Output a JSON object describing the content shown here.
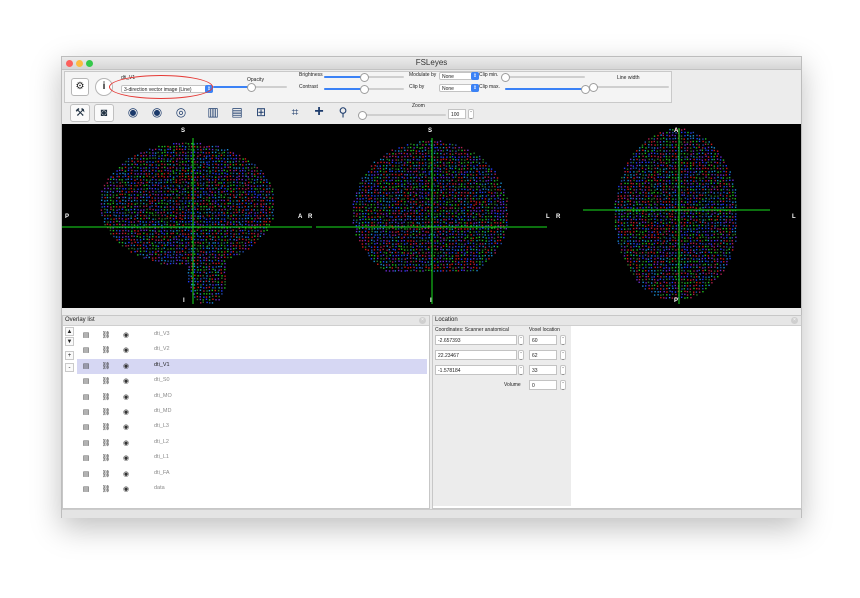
{
  "window": {
    "title": "FSLeyes"
  },
  "controls": {
    "overlay_name": "dti_V1",
    "overlay_type": "3-direction vector image (Line)",
    "opacity_label": "Opacity",
    "opacity_value": 0.52,
    "brightness_label": "Brightness",
    "brightness_value": 0.5,
    "contrast_label": "Contrast",
    "contrast_value": 0.5,
    "modulate_by_label": "Modulate by",
    "modulate_by_value": "None",
    "clip_by_label": "Clip by",
    "clip_by_value": "None",
    "clip_min_label": "Clip min.",
    "clip_min_value": 0.0,
    "clip_max_label": "Clip max.",
    "clip_max_value": 1.0,
    "line_width_label": "Line width",
    "line_width_value": 0.0
  },
  "toolbar": {
    "zoom_label": "Zoom",
    "zoom_value": "100",
    "zoom_slider_value": 0.0
  },
  "views": {
    "sagittal": {
      "top": "S",
      "bottom": "I",
      "left": "P",
      "right": "A"
    },
    "coronal": {
      "top": "S",
      "bottom": "I",
      "left": "R",
      "right": "L"
    },
    "axial": {
      "top": "A",
      "bottom": "P",
      "left": "R",
      "right": "L"
    },
    "cursor_color": "#19e01e"
  },
  "overlay_list": {
    "title": "Overlay list",
    "items": [
      {
        "name": "dti_V3",
        "selected": false
      },
      {
        "name": "dti_V2",
        "selected": false
      },
      {
        "name": "dti_V1",
        "selected": true
      },
      {
        "name": "dti_S0",
        "selected": false
      },
      {
        "name": "dti_MO",
        "selected": false
      },
      {
        "name": "dti_MD",
        "selected": false
      },
      {
        "name": "dti_L3",
        "selected": false
      },
      {
        "name": "dti_L2",
        "selected": false
      },
      {
        "name": "dti_L1",
        "selected": false
      },
      {
        "name": "dti_FA",
        "selected": false
      },
      {
        "name": "data",
        "selected": false
      }
    ],
    "side_buttons": [
      "▲",
      "▼",
      "+",
      "-"
    ]
  },
  "location": {
    "title": "Location",
    "coords_header": "Coordinates: Scanner anatomical",
    "voxel_header": "Voxel location",
    "coords": [
      "-2.657393",
      "22.23467",
      "-1.578184"
    ],
    "voxels": [
      "60",
      "62",
      "33"
    ],
    "volume_label": "Volume",
    "volume_value": "0"
  },
  "icons": {
    "gear": "⚙",
    "info": "i",
    "wrench": "🔧",
    "camera": "◙",
    "eye": "👁",
    "link": "🔗",
    "save": "▤",
    "plus": "+",
    "search": "⚲",
    "close": "×"
  }
}
